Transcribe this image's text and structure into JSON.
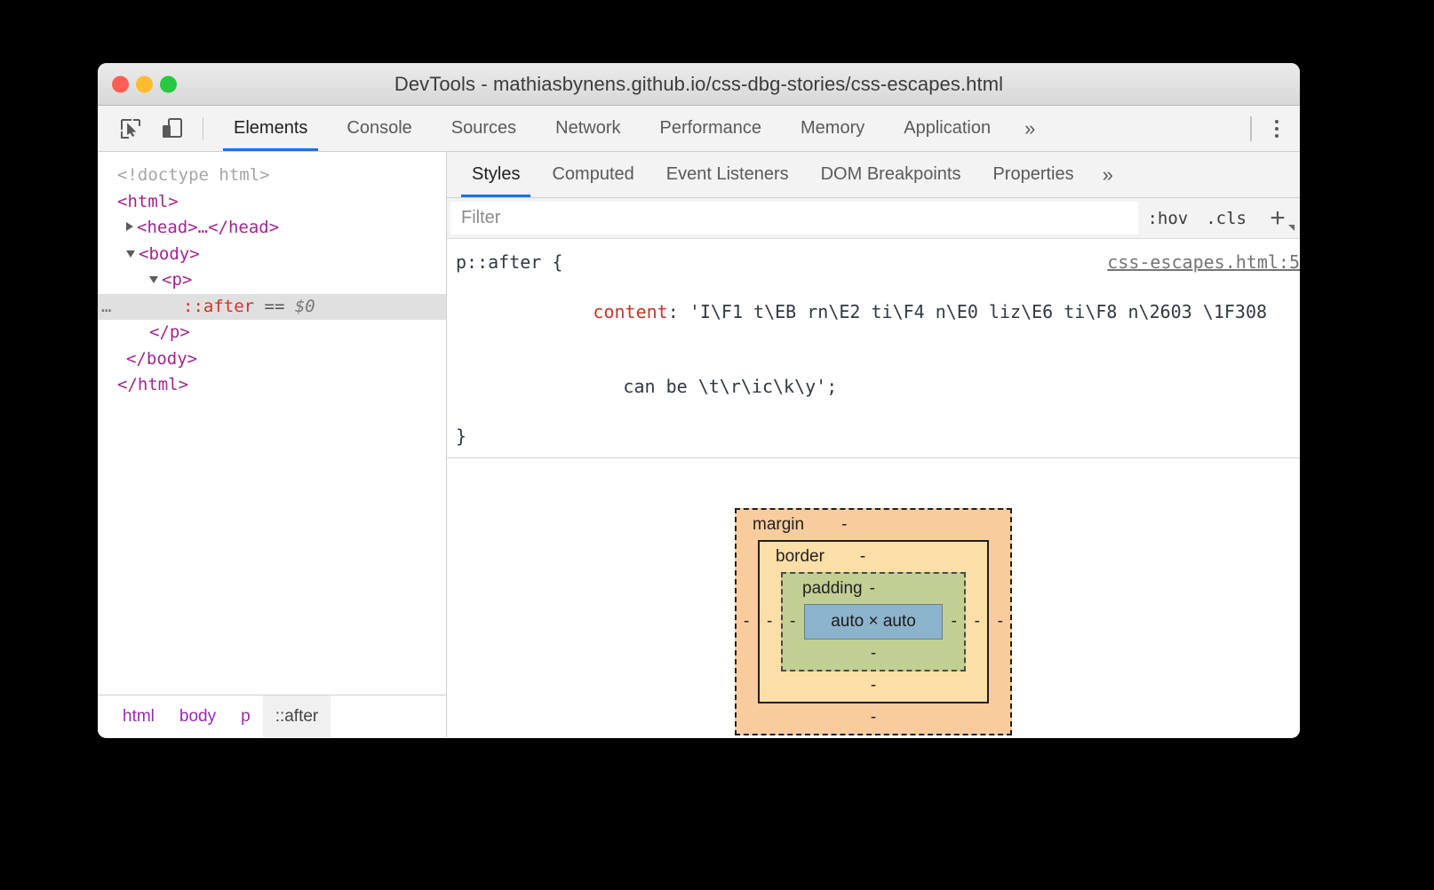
{
  "window": {
    "title": "DevTools - mathiasbynens.github.io/css-dbg-stories/css-escapes.html",
    "traffic_lights": {
      "close": "close-button",
      "minimize": "minimize-button",
      "zoom": "zoom-button"
    }
  },
  "toolbar": {
    "inspect_icon": "inspect-element-icon",
    "device_icon": "device-toolbar-icon",
    "tabs": [
      {
        "label": "Elements",
        "active": true
      },
      {
        "label": "Console",
        "active": false
      },
      {
        "label": "Sources",
        "active": false
      },
      {
        "label": "Network",
        "active": false
      },
      {
        "label": "Performance",
        "active": false
      },
      {
        "label": "Memory",
        "active": false
      },
      {
        "label": "Application",
        "active": false
      }
    ],
    "more_tabs": "»",
    "menu_icon": "kebab-menu-icon"
  },
  "dom_tree": {
    "lines": [
      {
        "text": "<!doctype html>",
        "type": "doctype",
        "indent": 0
      },
      {
        "text": "<html>",
        "type": "tag",
        "indent": 0
      },
      {
        "text": "<head>…</head>",
        "type": "tag",
        "indent": 1,
        "triangle": "closed"
      },
      {
        "text": "<body>",
        "type": "tag",
        "indent": 1,
        "triangle": "open"
      },
      {
        "text": "<p>",
        "type": "tag",
        "indent": 2,
        "triangle": "open"
      },
      {
        "text": "::after",
        "suffix": " == ",
        "dollar": "$0",
        "type": "pseudo",
        "indent": 3,
        "selected": true,
        "gutter": "…"
      },
      {
        "text": "</p>",
        "type": "tag",
        "indent": 2
      },
      {
        "text": "</body>",
        "type": "tag",
        "indent": 1
      },
      {
        "text": "</html>",
        "type": "tag",
        "indent": 0
      }
    ]
  },
  "breadcrumb": {
    "items": [
      {
        "label": "html",
        "active": false
      },
      {
        "label": "body",
        "active": false
      },
      {
        "label": "p",
        "active": false
      },
      {
        "label": "::after",
        "active": true
      }
    ]
  },
  "styles_panel": {
    "tabs": [
      {
        "label": "Styles",
        "active": true
      },
      {
        "label": "Computed",
        "active": false
      },
      {
        "label": "Event Listeners",
        "active": false
      },
      {
        "label": "DOM Breakpoints",
        "active": false
      },
      {
        "label": "Properties",
        "active": false
      }
    ],
    "more_tabs": "»",
    "filter": {
      "value": "",
      "placeholder": "Filter"
    },
    "hov_button": ":hov",
    "cls_button": ".cls",
    "new_rule_button": "+",
    "rule": {
      "selector": "p::after {",
      "source_link": "css-escapes.html:5",
      "property_name": "content",
      "property_value_line1": "'I\\F1 t\\EB rn\\E2 ti\\F4 n\\E0 liz\\E6 ti\\F8 n\\2603 \\1F308",
      "property_value_line2": "can be \\t\\r\\ic\\k\\y';",
      "closing_brace": "}"
    }
  },
  "box_model": {
    "margin_label": "margin",
    "margin_top": "-",
    "margin_right": "-",
    "margin_bottom": "-",
    "margin_left": "-",
    "border_label": "border",
    "border_top": "-",
    "border_right": "-",
    "border_bottom": "-",
    "border_left": "-",
    "padding_label": "padding",
    "padding_top": "-",
    "padding_right": "-",
    "padding_bottom": "-",
    "padding_left": "-",
    "content_size": "auto × auto",
    "colors": {
      "margin": "#f9cc9d",
      "border": "#fcdfa6",
      "padding": "#c2cf92",
      "content": "#8cb3cc"
    }
  },
  "theme": {
    "accent": "#1a73e8",
    "tag_color": "#a3248f",
    "pseudo_color": "#d93025",
    "property_color": "#c0392b"
  }
}
